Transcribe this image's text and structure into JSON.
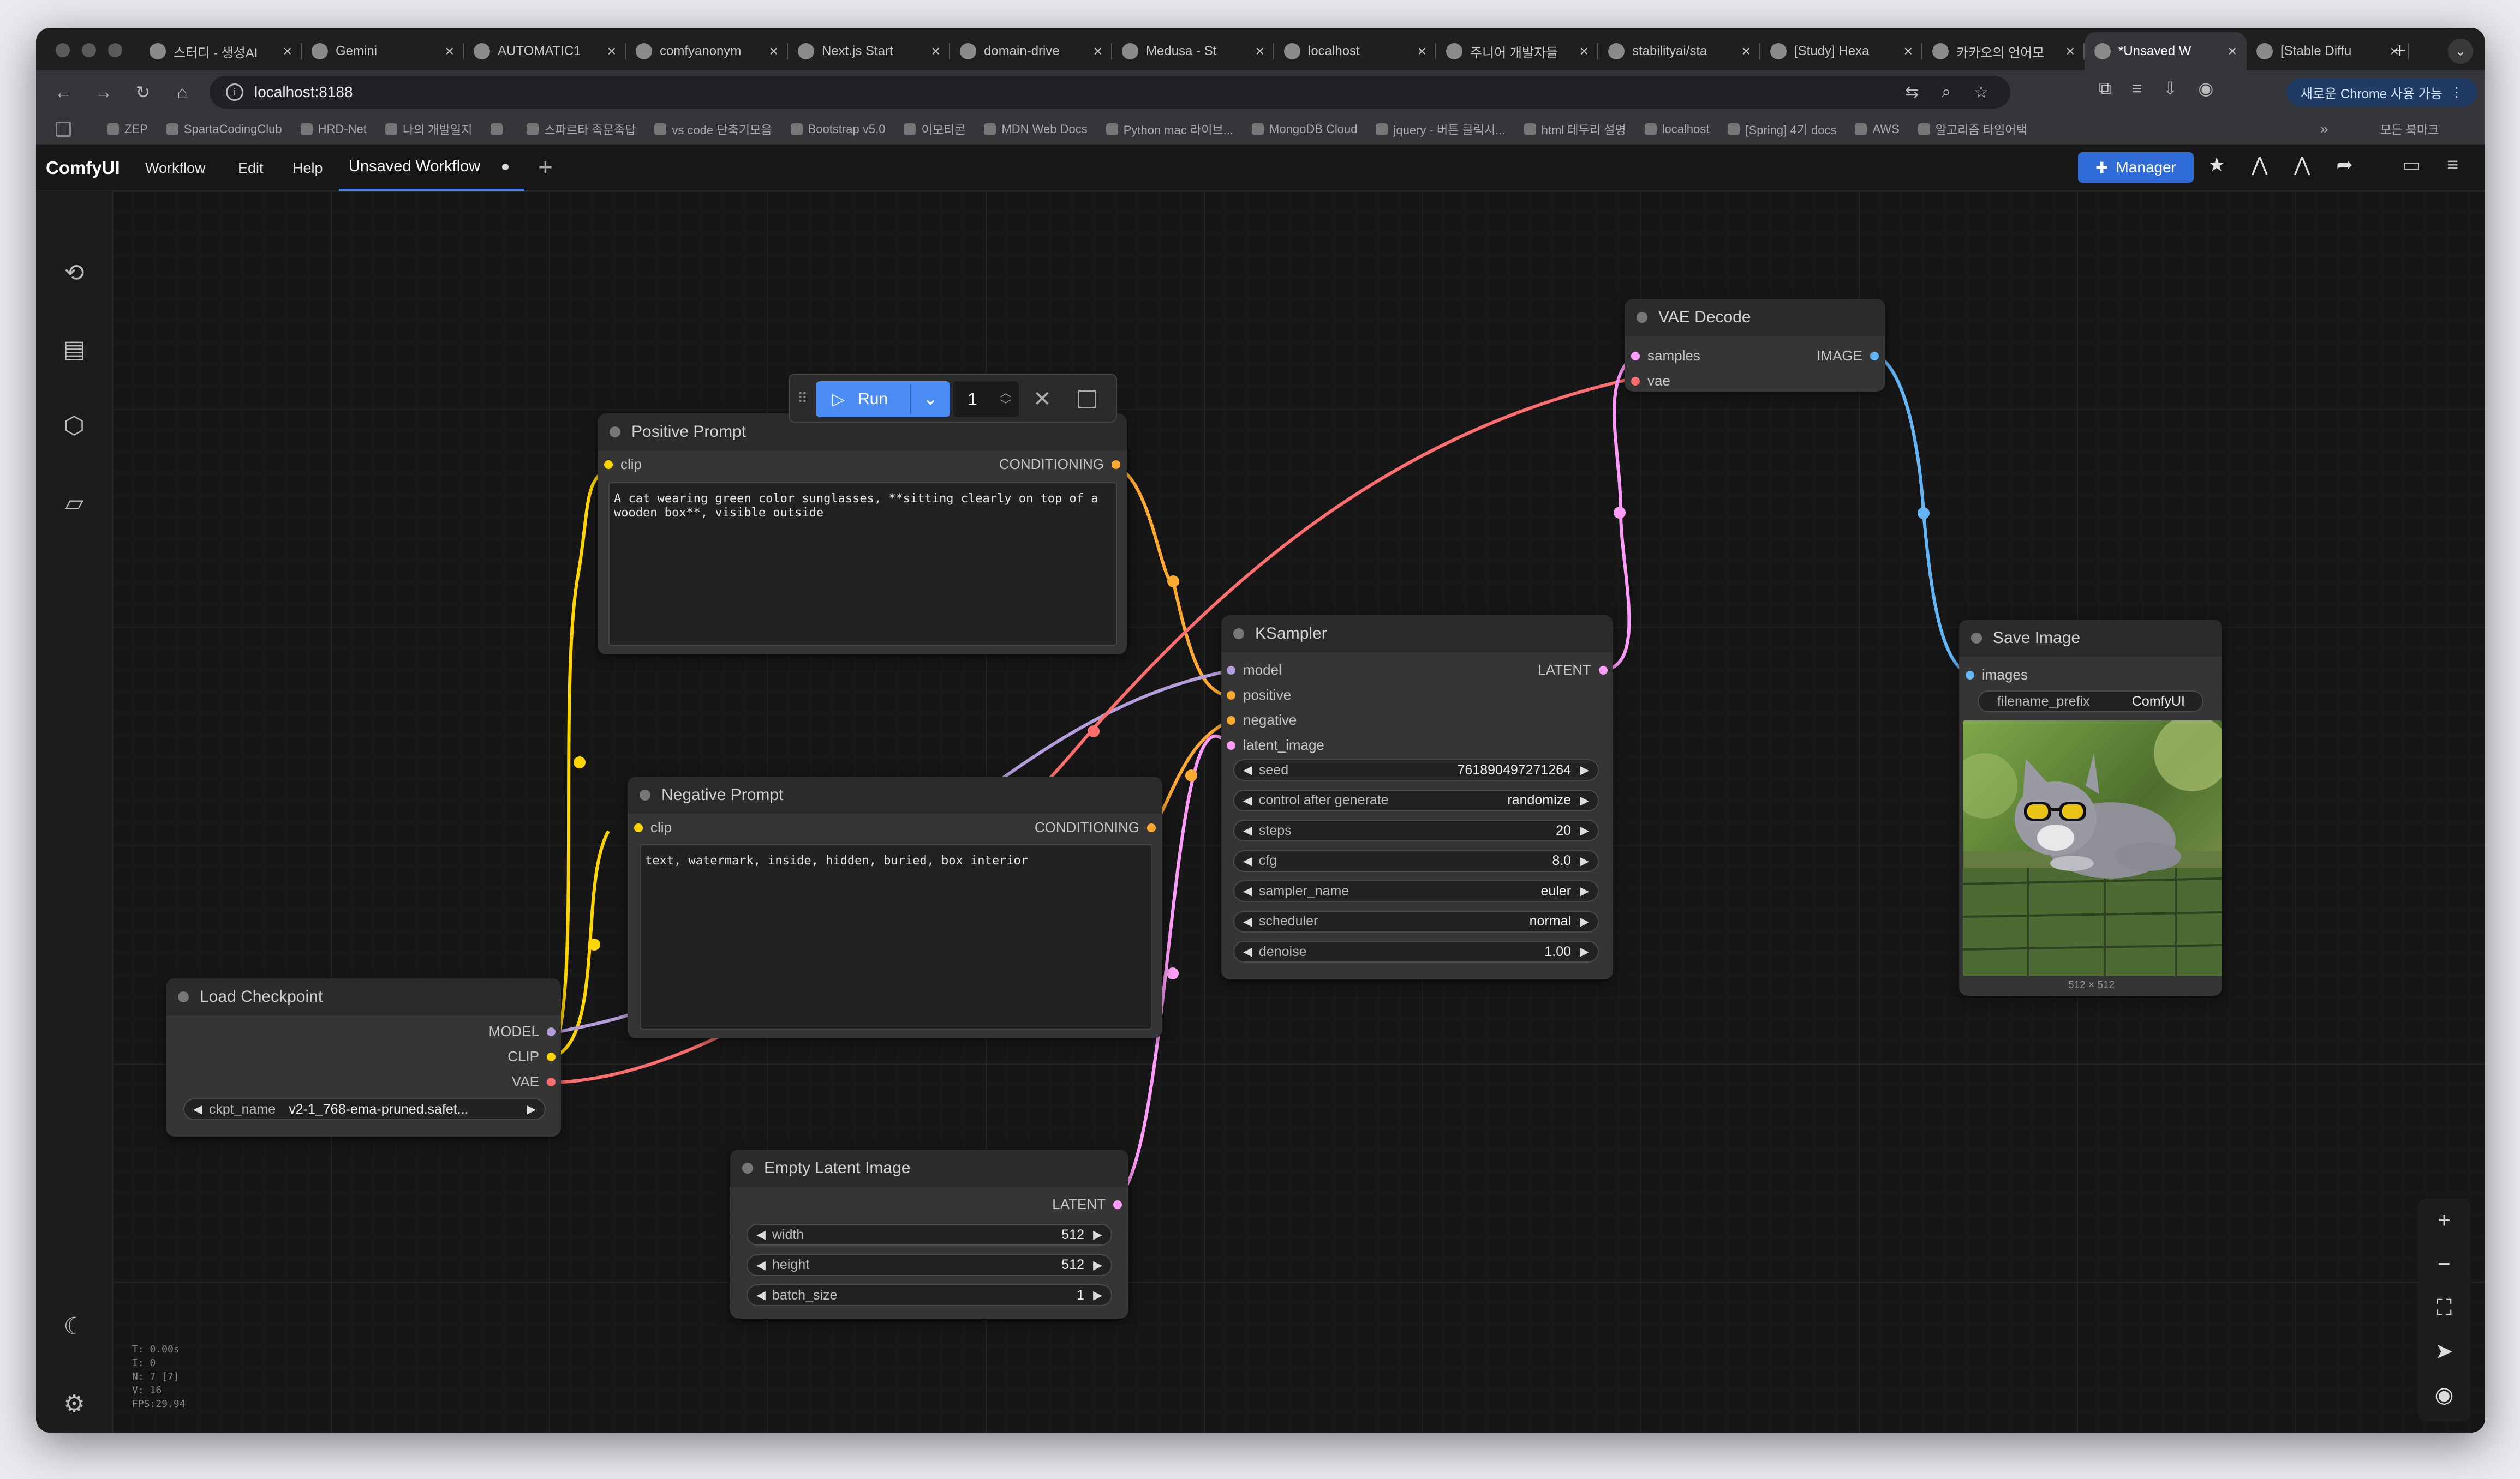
{
  "browser": {
    "tabs": [
      {
        "title": "스터디 - 생성AI",
        "icon": "globe"
      },
      {
        "title": "Gemini",
        "icon": "gemini"
      },
      {
        "title": "AUTOMATIC1",
        "icon": "github"
      },
      {
        "title": "comfyanonym",
        "icon": "github"
      },
      {
        "title": "Next.js Start",
        "icon": "nextjs"
      },
      {
        "title": "domain-drive",
        "icon": "github"
      },
      {
        "title": "Medusa - St",
        "icon": "medusa"
      },
      {
        "title": "localhost",
        "icon": "globe"
      },
      {
        "title": "주니어 개발자들",
        "icon": "page"
      },
      {
        "title": "stabilityai/sta",
        "icon": "hf"
      },
      {
        "title": "[Study] Hexa",
        "icon": "vue"
      },
      {
        "title": "카카오의 언어모",
        "icon": "kakao"
      },
      {
        "title": "*Unsaved W",
        "icon": "globe",
        "active": true
      },
      {
        "title": "[Stable Diffu",
        "icon": "dash"
      }
    ],
    "url": "localhost:8188",
    "chrome_button": "새로운 Chrome 사용 가능",
    "bookmarks": [
      "ZEP",
      "SpartaCodingClub",
      "HRD-Net",
      "나의 개발일지",
      "",
      "스파르타 족문족답",
      "vs code 단축기모음",
      "Bootstrap v5.0",
      "이모티콘",
      "MDN Web Docs",
      "Python mac 라이브...",
      "MongoDB Cloud",
      "jquery - 버튼 클릭시...",
      "html 테두리 설명",
      "localhost",
      "[Spring] 4기 docs",
      "AWS",
      "알고리즘 타임어택"
    ],
    "bookmarks_more": "»",
    "bookmarks_all": "모든 북마크"
  },
  "comfy": {
    "logo": "ComfyUI",
    "menu": [
      "Workflow",
      "Edit",
      "Help"
    ],
    "workflow_tab": "Unsaved Workflow",
    "manager_label": "Manager",
    "run": {
      "label": "Run",
      "count": "1"
    },
    "stats": [
      "T: 0.00s",
      "I: 0",
      "N: 7 [7]",
      "V: 16",
      "FPS:29.94"
    ]
  },
  "nodes": {
    "positive": {
      "title": "Positive Prompt",
      "in": "clip",
      "out": "CONDITIONING",
      "text": "A cat wearing green color sunglasses, **sitting clearly on top of a wooden box**, visible outside"
    },
    "negative": {
      "title": "Negative Prompt",
      "in": "clip",
      "out": "CONDITIONING",
      "text": "text, watermark, inside, hidden, buried, box interior"
    },
    "checkpoint": {
      "title": "Load Checkpoint",
      "outs": [
        "MODEL",
        "CLIP",
        "VAE"
      ],
      "ckpt_label": "ckpt_name",
      "ckpt_value": "v2-1_768-ema-pruned.safet..."
    },
    "ksampler": {
      "title": "KSampler",
      "ins": [
        "model",
        "positive",
        "negative",
        "latent_image"
      ],
      "out": "LATENT",
      "widgets": [
        {
          "label": "seed",
          "value": "761890497271264"
        },
        {
          "label": "control after generate",
          "value": "randomize"
        },
        {
          "label": "steps",
          "value": "20"
        },
        {
          "label": "cfg",
          "value": "8.0"
        },
        {
          "label": "sampler_name",
          "value": "euler"
        },
        {
          "label": "scheduler",
          "value": "normal"
        },
        {
          "label": "denoise",
          "value": "1.00"
        }
      ]
    },
    "vae_decode": {
      "title": "VAE Decode",
      "ins": [
        "samples",
        "vae"
      ],
      "out": "IMAGE"
    },
    "save_image": {
      "title": "Save Image",
      "in": "images",
      "prefix_label": "filename_prefix",
      "prefix_value": "ComfyUI",
      "image_caption": "512 × 512"
    },
    "empty_latent": {
      "title": "Empty Latent Image",
      "out": "LATENT",
      "widgets": [
        {
          "label": "width",
          "value": "512"
        },
        {
          "label": "height",
          "value": "512"
        },
        {
          "label": "batch_size",
          "value": "1"
        }
      ]
    }
  },
  "colors": {
    "clip": "#ffd500",
    "conditioning": "#ffa931",
    "model": "#b39ddb",
    "vae": "#ff6e6e",
    "latent": "#ff9cf9",
    "image": "#64b5f6",
    "accent": "#4b8cf5"
  }
}
